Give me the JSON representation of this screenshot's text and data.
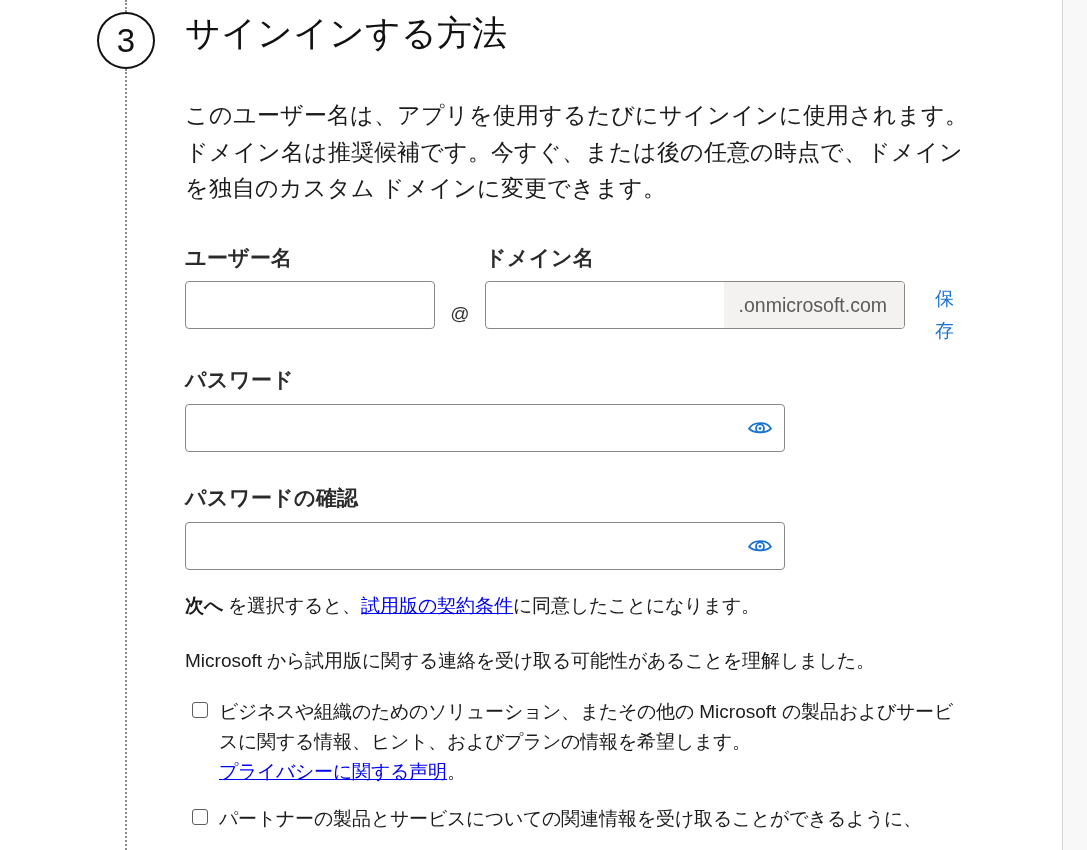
{
  "step": {
    "number": "3",
    "title": "サインインする方法"
  },
  "description": "このユーザー名は、アプリを使用するたびにサインインに使用されます。ドメイン名は推奨候補です。今すぐ、または後の任意の時点で、ドメインを独自のカスタム ドメインに変更できます。",
  "username": {
    "label": "ユーザー名"
  },
  "at_sign": "@",
  "domain": {
    "label": "ドメイン名",
    "suffix": ".onmicrosoft.com",
    "save_link": "保存"
  },
  "password_fields": [
    {
      "label": "パスワード"
    },
    {
      "label": "パスワードの確認"
    }
  ],
  "terms": {
    "text": "**次へ** を選択すると、",
    "link": "試用版の契約条件",
    "text_after": "に同意したことになります。"
  },
  "notice": "Microsoft から試用版に関する連絡を受け取る可能性があることを理解しました。",
  "consents": [
    {
      "text": "ビジネスや組織のためのソリューション、またその他の Microsoft の製品およびサービスに関する情報、ヒント、およびプランの情報を希望します。",
      "link": "プライバシーに関する声明",
      "text_after": "。",
      "checked": false
    },
    {
      "text": "パートナーの製品とサービスについての関連情報を受け取ることができるように、",
      "checked": false
    }
  ]
}
